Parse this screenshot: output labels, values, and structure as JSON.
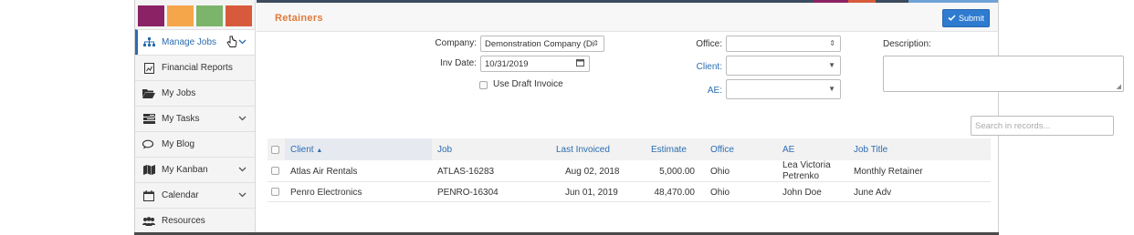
{
  "colors": {
    "accent": "#2e7bcf",
    "title": "#e07a3a",
    "tiles": [
      "#8b2265",
      "#f5a64a",
      "#7cb46b",
      "#d75a3c"
    ]
  },
  "sidebar": {
    "items": [
      {
        "label": "Manage Jobs",
        "icon": "sitemap-icon",
        "has_chevron": true,
        "active": true
      },
      {
        "label": "Financial Reports",
        "icon": "report-icon",
        "has_chevron": false
      },
      {
        "label": "My Jobs",
        "icon": "folder-open-icon",
        "has_chevron": false
      },
      {
        "label": "My Tasks",
        "icon": "tasks-icon",
        "has_chevron": true
      },
      {
        "label": "My Blog",
        "icon": "comments-icon",
        "has_chevron": false
      },
      {
        "label": "My Kanban",
        "icon": "map-icon",
        "has_chevron": true
      },
      {
        "label": "Calendar",
        "icon": "calendar-icon",
        "has_chevron": true
      },
      {
        "label": "Resources",
        "icon": "users-icon",
        "has_chevron": false
      }
    ]
  },
  "header": {
    "title": "Retainers",
    "submit_label": "Submit"
  },
  "form": {
    "company_label": "Company:",
    "company_value": "Demonstration Company (Di",
    "inv_date_label": "Inv Date:",
    "inv_date_value": "10/31/2019",
    "draft_label": "Use Draft Invoice",
    "office_label": "Office:",
    "office_value": "",
    "client_label": "Client:",
    "client_value": "",
    "ae_label": "AE:",
    "ae_value": "",
    "description_label": "Description:",
    "description_value": ""
  },
  "search": {
    "placeholder": "Search in records..."
  },
  "table": {
    "headers": [
      "Client",
      "Job",
      "Last Invoiced",
      "Estimate",
      "Office",
      "AE",
      "Job Title"
    ],
    "sort_indicator": "▲",
    "rows": [
      {
        "client": "Atlas Air Rentals",
        "job": "ATLAS-16283",
        "last_invoiced": "Aug 02, 2018",
        "estimate": "5,000.00",
        "office": "Ohio",
        "ae_line1": "Lea Victoria",
        "ae_line2": "Petrenko",
        "job_title": "Monthly Retainer"
      },
      {
        "client": "Penro Electronics",
        "job": "PENRO-16304",
        "last_invoiced": "Jun 01, 2019",
        "estimate": "48,470.00",
        "office": "Ohio",
        "ae_line1": "John Doe",
        "ae_line2": "",
        "job_title": "June Adv"
      }
    ]
  }
}
